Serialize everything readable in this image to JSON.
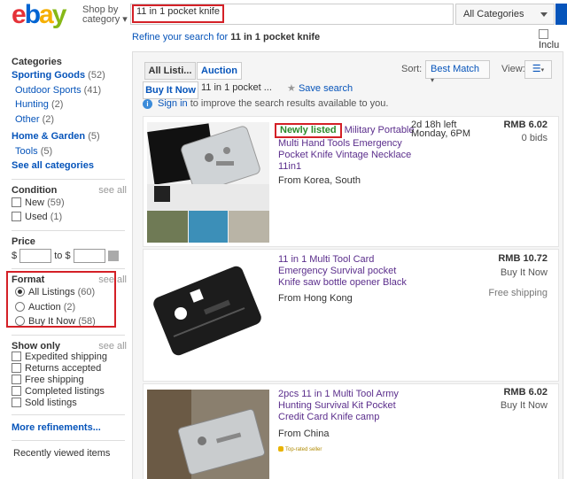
{
  "header": {
    "logo": [
      "e",
      "b",
      "a",
      "y"
    ],
    "shop_by": "Shop by",
    "shop_by_2": "category",
    "search_value": "11 in 1 pocket knife",
    "category_select": "All Categories",
    "include_label": "Inclu"
  },
  "refine": {
    "prefix": "Refine your search",
    "middle": " for ",
    "query": "11 in 1 pocket knife"
  },
  "sidebar": {
    "categories_heading": "Categories",
    "categories": [
      {
        "label": "Sporting Goods",
        "count": "(52)"
      },
      {
        "label": "Outdoor Sports",
        "count": "(41)"
      },
      {
        "label": "Hunting",
        "count": "(2)"
      },
      {
        "label": "Other",
        "count": "(2)"
      },
      {
        "label": "Home & Garden",
        "count": "(5)"
      },
      {
        "label": "Tools",
        "count": "(5)"
      }
    ],
    "see_all_categories": "See all categories",
    "condition_heading": "Condition",
    "see_all": "see all",
    "condition": [
      {
        "label": "New",
        "count": "(59)"
      },
      {
        "label": "Used",
        "count": "(1)"
      }
    ],
    "price_heading": "Price",
    "price_from": "$",
    "price_to": "to $",
    "format_heading": "Format",
    "format": [
      {
        "label": "All Listings",
        "count": "(60)",
        "selected": true
      },
      {
        "label": "Auction",
        "count": "(2)",
        "selected": false
      },
      {
        "label": "Buy It Now",
        "count": "(58)",
        "selected": false
      }
    ],
    "show_only_heading": "Show only",
    "show_only": [
      "Expedited shipping",
      "Returns accepted",
      "Free shipping",
      "Completed listings",
      "Sold listings"
    ],
    "more_refinements": "More refinements...",
    "recently_viewed": "Recently viewed items"
  },
  "results": {
    "tab_all": "All Listi...",
    "tab_auction": "Auction",
    "tab_bin": "Buy It Now",
    "query_snip": "11 in 1 pocket ...",
    "save_search": "Save search",
    "sort_label": "Sort:",
    "sort_value": "Best Match",
    "view_label": "View:",
    "signin_link": "Sign in",
    "signin_text": " to improve the search results available to you."
  },
  "items": [
    {
      "newly_listed": "Newly listed",
      "title": " Military Portable Multi Hand Tools Emergency Pocket Knife Vintage Necklace 11in1",
      "location": "From Korea, South",
      "time_left": "2d 18h left",
      "time_end": "Monday, 6PM",
      "price": "RMB 6.02",
      "format": "0 bids",
      "shipping": ""
    },
    {
      "newly_listed": "",
      "title": "11 in 1 Multi Tool Card Emergency Survival pocket Knife saw bottle opener Black",
      "location": "From Hong Kong",
      "time_left": "",
      "time_end": "",
      "price": "RMB 10.72",
      "format": "Buy It Now",
      "shipping": "Free shipping"
    },
    {
      "newly_listed": "",
      "title": "2pcs 11 in 1 Multi Tool Army Hunting Survival Kit Pocket Credit Card Knife camp",
      "location": "From China",
      "time_left": "",
      "time_end": "",
      "price": "RMB 6.02",
      "format": "Buy It Now",
      "shipping": "",
      "badge": "Top-rated seller"
    }
  ],
  "colors": {
    "link": "#0654ba",
    "highlight_box": "#d42027",
    "newly_listed": "#2a8a2a",
    "visited_title": "#5b2e8c"
  }
}
